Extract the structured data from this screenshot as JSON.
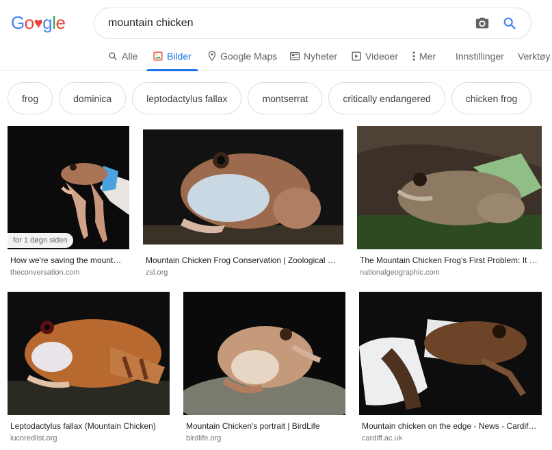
{
  "logo": {
    "letters": [
      "G",
      "o",
      "♥",
      "g",
      "l",
      "e"
    ]
  },
  "search": {
    "query": "mountain chicken"
  },
  "icons": {
    "camera": "camera-icon",
    "search": "search-icon"
  },
  "tabs": [
    {
      "label": "Alle",
      "icon": "search-icon"
    },
    {
      "label": "Bilder",
      "icon": "image-icon",
      "active": true
    },
    {
      "label": "Google Maps",
      "icon": "map-pin-icon"
    },
    {
      "label": "Nyheter",
      "icon": "newspaper-icon"
    },
    {
      "label": "Videoer",
      "icon": "video-icon"
    },
    {
      "label": "Mer",
      "icon": "more-vert-icon"
    },
    {
      "label": "Innstillinger"
    },
    {
      "label": "Verktøy"
    }
  ],
  "chips": [
    "frog",
    "dominica",
    "leptodactylus fallax",
    "montserrat",
    "critically endangered",
    "chicken frog"
  ],
  "results": [
    {
      "title": "How we're saving the mount…",
      "source": "theconversation.com",
      "badge": "for 1 døgn siden"
    },
    {
      "title": "Mountain Chicken Frog Conservation | Zoological …",
      "source": "zsl.org"
    },
    {
      "title": "The Mountain Chicken Frog's First Problem: It …",
      "source": "nationalgeographic.com"
    },
    {
      "title": "Leptodactylus fallax (Mountain Chicken)",
      "source": "iucnredlist.org"
    },
    {
      "title": "Mountain Chicken's portrait | BirdLife",
      "source": "birdlife.org"
    },
    {
      "title": "Mountain chicken on the edge - News - Cardif…",
      "source": "cardiff.ac.uk"
    }
  ],
  "colors": {
    "accent": "#1a73e8",
    "tab_text": "#5f6368",
    "chip_border": "#dadce0"
  }
}
